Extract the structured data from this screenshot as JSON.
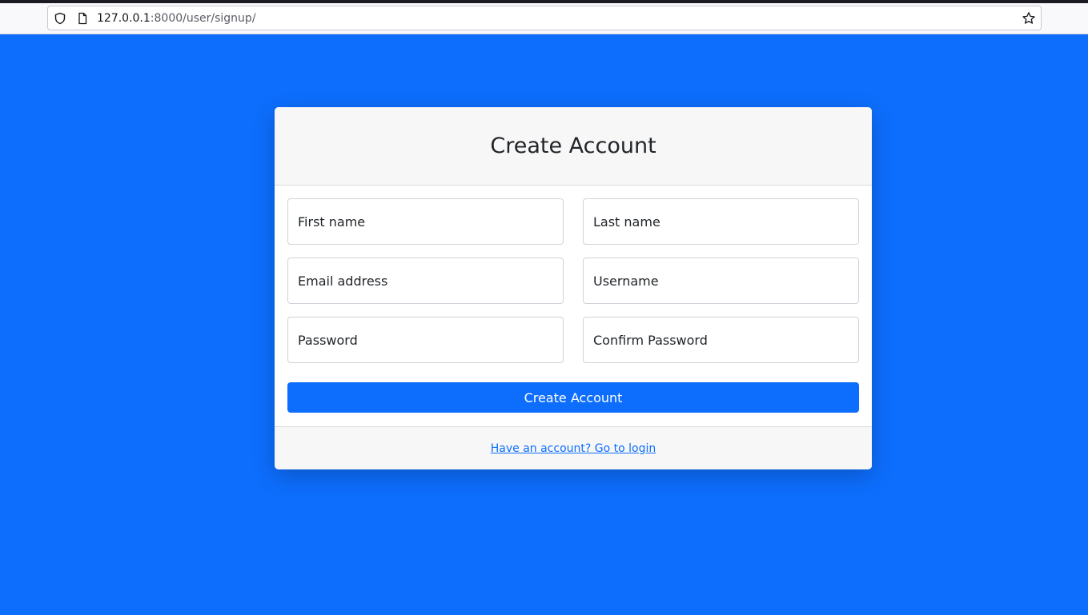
{
  "browser": {
    "url_host": "127.0.0.1",
    "url_path": ":8000/user/signup/"
  },
  "form": {
    "title": "Create Account",
    "fields": {
      "first_name": "First name",
      "last_name": "Last name",
      "email": "Email address",
      "username": "Username",
      "password": "Password",
      "confirm_password": "Confirm Password"
    },
    "submit_label": "Create Account",
    "login_link": "Have an account? Go to login"
  },
  "colors": {
    "background": "#0d6efd",
    "primary_button": "#0d6efd",
    "link": "#0d6efd"
  },
  "icons": [
    "shield-icon",
    "page-icon",
    "star-icon"
  ]
}
